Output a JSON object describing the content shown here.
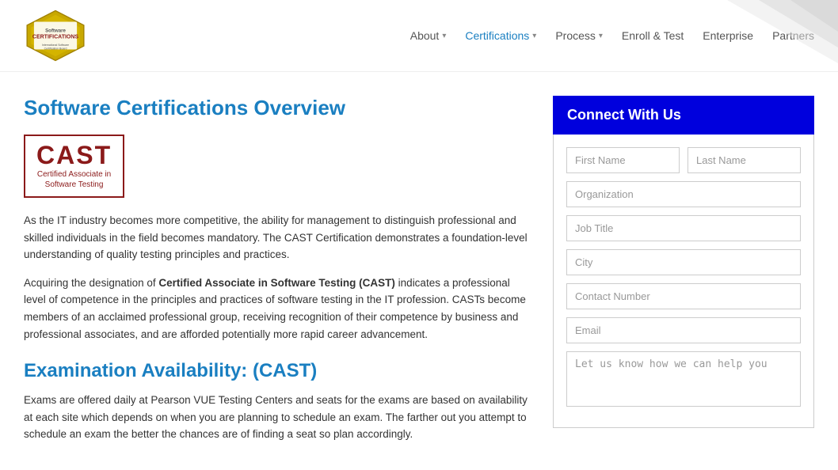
{
  "logo": {
    "line1": "Software",
    "line2": "CERTIFICATIONS",
    "line3": "International Software Certification Board"
  },
  "nav": {
    "items": [
      {
        "label": "About",
        "active": false,
        "hasDropdown": true
      },
      {
        "label": "Certifications",
        "active": true,
        "hasDropdown": true
      },
      {
        "label": "Process",
        "active": false,
        "hasDropdown": true
      },
      {
        "label": "Enroll & Test",
        "active": false,
        "hasDropdown": false
      },
      {
        "label": "Enterprise",
        "active": false,
        "hasDropdown": false
      },
      {
        "label": "Partners",
        "active": false,
        "hasDropdown": false
      }
    ]
  },
  "main": {
    "page_title": "Software Certifications Overview",
    "cast_logo": {
      "acronym": "CAST",
      "subtitle_line1": "Certified Associate in",
      "subtitle_line2": "Software Testing"
    },
    "paragraph1": "As the IT industry becomes more competitive, the ability for management to distinguish professional and skilled individuals in the field becomes mandatory. The CAST Certification demonstrates a foundation-level understanding of quality testing principles and practices.",
    "paragraph2_prefix": "Acquiring the designation of ",
    "paragraph2_bold": "Certified Associate in Software Testing (CAST)",
    "paragraph2_suffix": " indicates a professional level of competence in the principles and practices of software testing in the IT profession. CASTs become members of an acclaimed professional group, receiving recognition of their competence by business and professional associates, and are afforded potentially more rapid career advancement.",
    "exam_title": "Examination Availability: (CAST)",
    "exam_paragraph": "Exams are offered daily at Pearson VUE Testing Centers and seats for the exams are based on availability at each site which depends on when you are planning to schedule an exam. The farther out you attempt to schedule an exam the better the chances are of finding a seat so plan accordingly."
  },
  "sidebar": {
    "header": "Connect With Us",
    "form": {
      "first_name_placeholder": "First Name",
      "last_name_placeholder": "Last Name",
      "organization_placeholder": "Organization",
      "job_title_placeholder": "Job Title",
      "city_placeholder": "City",
      "contact_number_placeholder": "Contact Number",
      "email_placeholder": "Email",
      "message_placeholder": "Let us know how we can help you"
    }
  }
}
